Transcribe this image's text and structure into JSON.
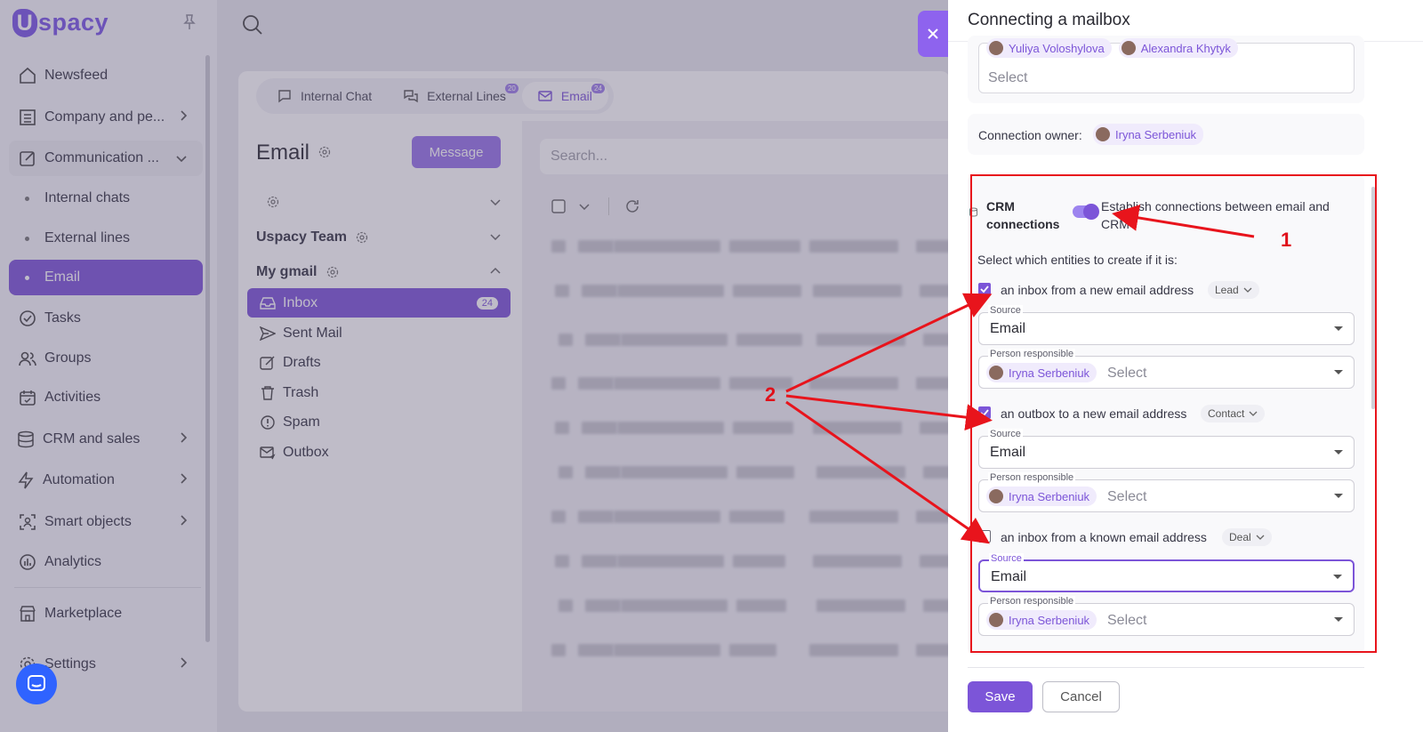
{
  "app": {
    "logo": "spacy",
    "logo_mark": "U"
  },
  "sidebar": {
    "items": [
      {
        "label": "Newsfeed"
      },
      {
        "label": "Company and pe..."
      },
      {
        "label": "Communication ..."
      },
      {
        "label": "Tasks"
      },
      {
        "label": "Groups"
      },
      {
        "label": "Activities"
      },
      {
        "label": "CRM and sales"
      },
      {
        "label": "Automation"
      },
      {
        "label": "Smart objects"
      },
      {
        "label": "Analytics"
      },
      {
        "label": "Marketplace"
      },
      {
        "label": "Settings"
      }
    ],
    "subitems": [
      {
        "label": "Internal chats"
      },
      {
        "label": "External lines"
      },
      {
        "label": "Email"
      }
    ]
  },
  "tabs": [
    {
      "label": "Internal Chat",
      "badge": ""
    },
    {
      "label": "External Lines",
      "badge": "20"
    },
    {
      "label": "Email",
      "badge": "24"
    }
  ],
  "mail": {
    "title": "Email",
    "message_button": "Message",
    "search_placeholder": "Search...",
    "groups": [
      "Uspacy Team",
      "My gmail"
    ],
    "folders": [
      {
        "label": "Inbox",
        "count": "24"
      },
      {
        "label": "Sent Mail"
      },
      {
        "label": "Drafts"
      },
      {
        "label": "Trash"
      },
      {
        "label": "Spam"
      },
      {
        "label": "Outbox"
      }
    ]
  },
  "panel": {
    "title": "Connecting a mailbox",
    "users_chips": [
      "Yuliya Voloshylova",
      "Alexandra Khytyk"
    ],
    "users_placeholder": "Select",
    "owner_label": "Connection owner:",
    "owner_name": "Iryna Serbeniuk",
    "crm_title_1": "CRM",
    "crm_title_2": "connections",
    "crm_toggle_text_1": "Establish connections between email and",
    "crm_toggle_text_2": "CRM",
    "crm_toggle_on": true,
    "entities_prompt": "Select which entities to create if it is:",
    "rules": [
      {
        "checked": true,
        "text": "an inbox from a new email address",
        "entity": "Lead",
        "source_label": "Source",
        "source": "Email",
        "person_label": "Person responsible",
        "person": "Iryna Serbeniuk",
        "person_placeholder": "Select"
      },
      {
        "checked": true,
        "text": "an outbox to a new email address",
        "entity": "Contact",
        "source_label": "Source",
        "source": "Email",
        "person_label": "Person responsible",
        "person": "Iryna Serbeniuk",
        "person_placeholder": "Select"
      },
      {
        "checked": false,
        "text": "an inbox from a known email address",
        "entity": "Deal",
        "source_label": "Source",
        "source": "Email",
        "person_label": "Person responsible",
        "person": "Iryna Serbeniuk",
        "person_placeholder": "Select"
      }
    ],
    "save": "Save",
    "cancel": "Cancel"
  },
  "annotations": {
    "one": "1",
    "two": "2"
  },
  "colors": {
    "accent": "#7c55d8",
    "annotation": "#e8141c"
  }
}
